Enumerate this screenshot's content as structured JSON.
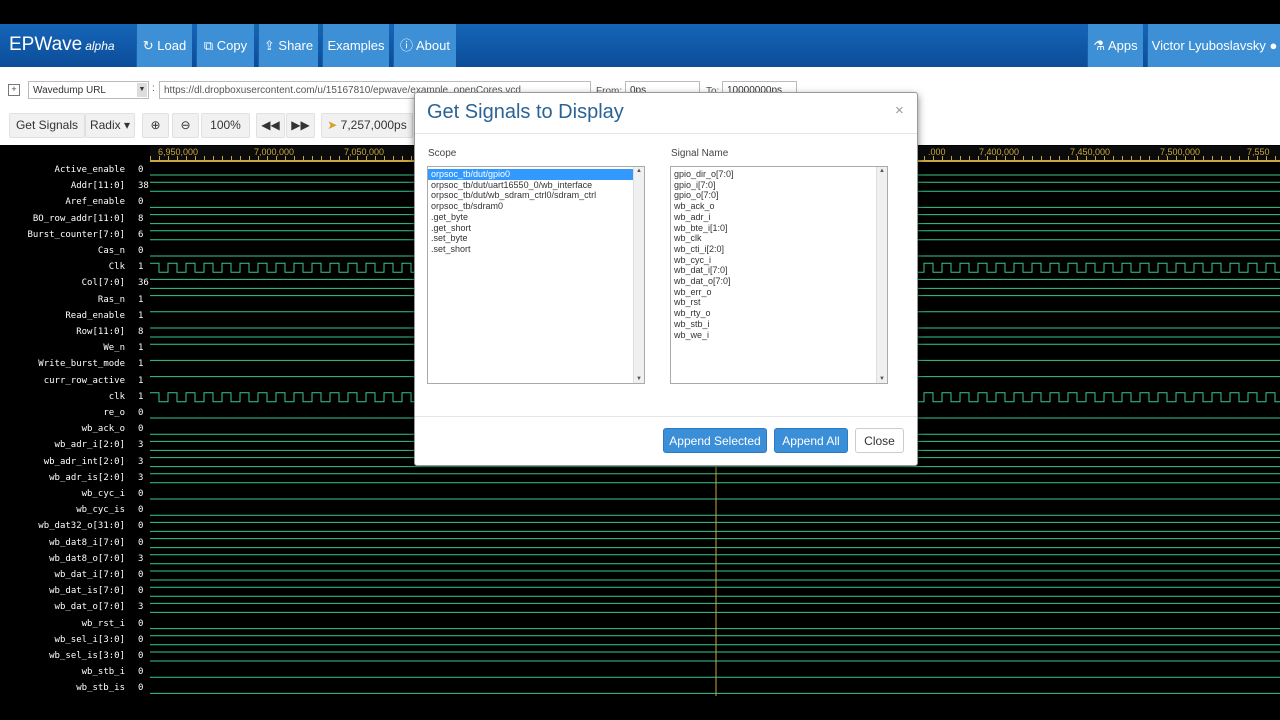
{
  "navbar": {
    "brand": "EPWave",
    "brand_sub": "alpha",
    "load": "Load",
    "copy": "Copy",
    "share": "Share",
    "examples": "Examples",
    "about": "About",
    "apps": "Apps",
    "user": "Victor Lyuboslavsky"
  },
  "source": {
    "type": "Wavedump URL",
    "url": "https://dl.dropboxusercontent.com/u/15167810/epwave/example_openCores.vcd",
    "from_label": "From:",
    "from_value": "0ps",
    "to_label": "To:",
    "to_value": "10000000ps"
  },
  "toolbar": {
    "get_signals": "Get Signals",
    "radix": "Radix",
    "zoom": "100%",
    "cursor": "7,257,000ps"
  },
  "ruler": {
    "ticks": [
      "6,950,000",
      "7,000,000",
      "7,050,000",
      ".000",
      "7,400,000",
      "7,450,000",
      "7,500,000",
      "7,550"
    ]
  },
  "signals": [
    {
      "name": "Active_enable",
      "value": "0"
    },
    {
      "name": "Addr[11:0]",
      "value": "38"
    },
    {
      "name": "Aref_enable",
      "value": "0"
    },
    {
      "name": "BO_row_addr[11:0]",
      "value": "8"
    },
    {
      "name": "Burst_counter[7:0]",
      "value": "6"
    },
    {
      "name": "Cas_n",
      "value": "0"
    },
    {
      "name": "Clk",
      "value": "1"
    },
    {
      "name": "Col[7:0]",
      "value": "36"
    },
    {
      "name": "Ras_n",
      "value": "1"
    },
    {
      "name": "Read_enable",
      "value": "1"
    },
    {
      "name": "Row[11:0]",
      "value": "8"
    },
    {
      "name": "We_n",
      "value": "1"
    },
    {
      "name": "Write_burst_mode",
      "value": "1"
    },
    {
      "name": "curr_row_active",
      "value": "1"
    },
    {
      "name": "clk",
      "value": "1"
    },
    {
      "name": "re_o",
      "value": "0"
    },
    {
      "name": "wb_ack_o",
      "value": "0"
    },
    {
      "name": "wb_adr_i[2:0]",
      "value": "3"
    },
    {
      "name": "wb_adr_int[2:0]",
      "value": "3"
    },
    {
      "name": "wb_adr_is[2:0]",
      "value": "3"
    },
    {
      "name": "wb_cyc_i",
      "value": "0"
    },
    {
      "name": "wb_cyc_is",
      "value": "0"
    },
    {
      "name": "wb_dat32_o[31:0]",
      "value": "0"
    },
    {
      "name": "wb_dat8_i[7:0]",
      "value": "0"
    },
    {
      "name": "wb_dat8_o[7:0]",
      "value": "3"
    },
    {
      "name": "wb_dat_i[7:0]",
      "value": "0"
    },
    {
      "name": "wb_dat_is[7:0]",
      "value": "0"
    },
    {
      "name": "wb_dat_o[7:0]",
      "value": "3"
    },
    {
      "name": "wb_rst_i",
      "value": "0"
    },
    {
      "name": "wb_sel_i[3:0]",
      "value": "0"
    },
    {
      "name": "wb_sel_is[3:0]",
      "value": "0"
    },
    {
      "name": "wb_stb_i",
      "value": "0"
    },
    {
      "name": "wb_stb_is",
      "value": "0"
    }
  ],
  "modal": {
    "title": "Get Signals to Display",
    "close_x": "×",
    "scope_label": "Scope",
    "signal_label": "Signal Name",
    "scope_items": [
      "orpsoc_tb/dut/gpio0",
      "orpsoc_tb/dut/uart16550_0/wb_interface",
      "orpsoc_tb/dut/wb_sdram_ctrl0/sdram_ctrl",
      "orpsoc_tb/sdram0",
      ".get_byte",
      ".get_short",
      ".set_byte",
      ".set_short"
    ],
    "signal_items": [
      "gpio_dir_o[7:0]",
      "gpio_i[7:0]",
      "gpio_o[7:0]",
      "wb_ack_o",
      "wb_adr_i",
      "wb_bte_i[1:0]",
      "wb_clk",
      "wb_cti_i[2:0]",
      "wb_cyc_i",
      "wb_dat_i[7:0]",
      "wb_dat_o[7:0]",
      "wb_err_o",
      "wb_rst",
      "wb_rty_o",
      "wb_stb_i",
      "wb_we_i"
    ],
    "append_selected": "Append Selected",
    "append_all": "Append All",
    "close": "Close"
  },
  "colors": {
    "navbar": "#0b4d99",
    "wave": "#38c98a",
    "bus_text": "#9fe8ff",
    "ruler": "#c8a640",
    "cursor": "#c8a640"
  }
}
